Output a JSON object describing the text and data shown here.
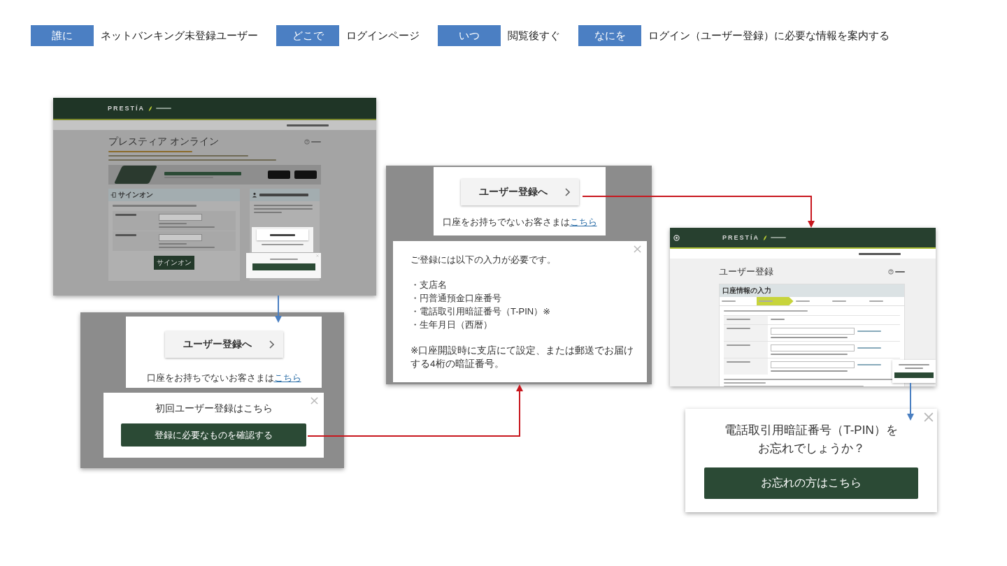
{
  "tags": [
    {
      "label": "誰に",
      "value": "ネットバンキング未登録ユーザー"
    },
    {
      "label": "どこで",
      "value": "ログインページ"
    },
    {
      "label": "いつ",
      "value": "閲覧後すぐ"
    },
    {
      "label": "なにを",
      "value": "ログイン（ユーザー登録）に必要な情報を案内する"
    }
  ],
  "login_thumbnail": {
    "logo": "PRESTÍA",
    "title": "プレスティア オンライン",
    "signon_heading": "サインオン",
    "signon_button": "サインオン"
  },
  "register_popup_zoom": {
    "register_button": "ユーザー登録へ",
    "no_account_text": "口座をお持ちでないお客さまは",
    "no_account_link": "こちら",
    "popup_title": "初回ユーザー登録はこちら",
    "popup_button": "登録に必要なものを確認する"
  },
  "requirements_popup_zoom": {
    "register_button": "ユーザー登録へ",
    "no_account_text": "口座をお持ちでないお客さまは",
    "no_account_link": "こちら",
    "intro": "ご登録には以下の入力が必要です。",
    "items": [
      "・支店名",
      "・円普通預金口座番号",
      "・電話取引用暗証番号（T-PIN）※",
      "・生年月日（西暦）"
    ],
    "note": "※口座開設時に支店にて設定、または郵送でお届けする4桁の暗証番号。"
  },
  "registration_thumbnail": {
    "logo": "PRESTÍA",
    "title": "ユーザー登録",
    "section": "口座情報の入力",
    "steps": [
      {
        "selected": false
      },
      {
        "selected": true
      },
      {
        "selected": false
      },
      {
        "selected": false
      },
      {
        "selected": false
      }
    ]
  },
  "tpin_popup_zoom": {
    "message": "電話取引用暗証番号（T-PIN）をお忘れでしょうか？",
    "button": "お忘れの方はこちら"
  }
}
